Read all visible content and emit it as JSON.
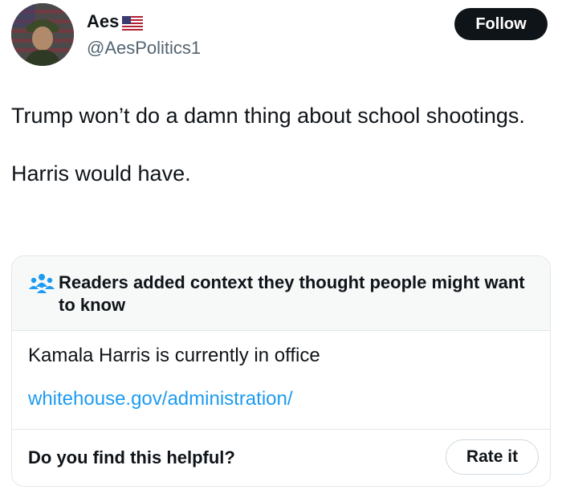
{
  "author": {
    "display_name": "Aes",
    "flag_icon": "us-flag-icon",
    "handle": "@AesPolitics1"
  },
  "follow_button": {
    "label": "Follow"
  },
  "tweet": {
    "paragraphs": [
      "Trump won’t do a damn thing about school shootings.",
      "Harris would have."
    ]
  },
  "community_note": {
    "icon": "people-icon",
    "title": "Readers added context they thought people might want to know",
    "body": "Kamala Harris is currently in office",
    "link": "whitehouse.gov/administration/",
    "link_color": "#1d9bf0",
    "question": "Do you find this helpful?",
    "rate_label": "Rate it"
  }
}
